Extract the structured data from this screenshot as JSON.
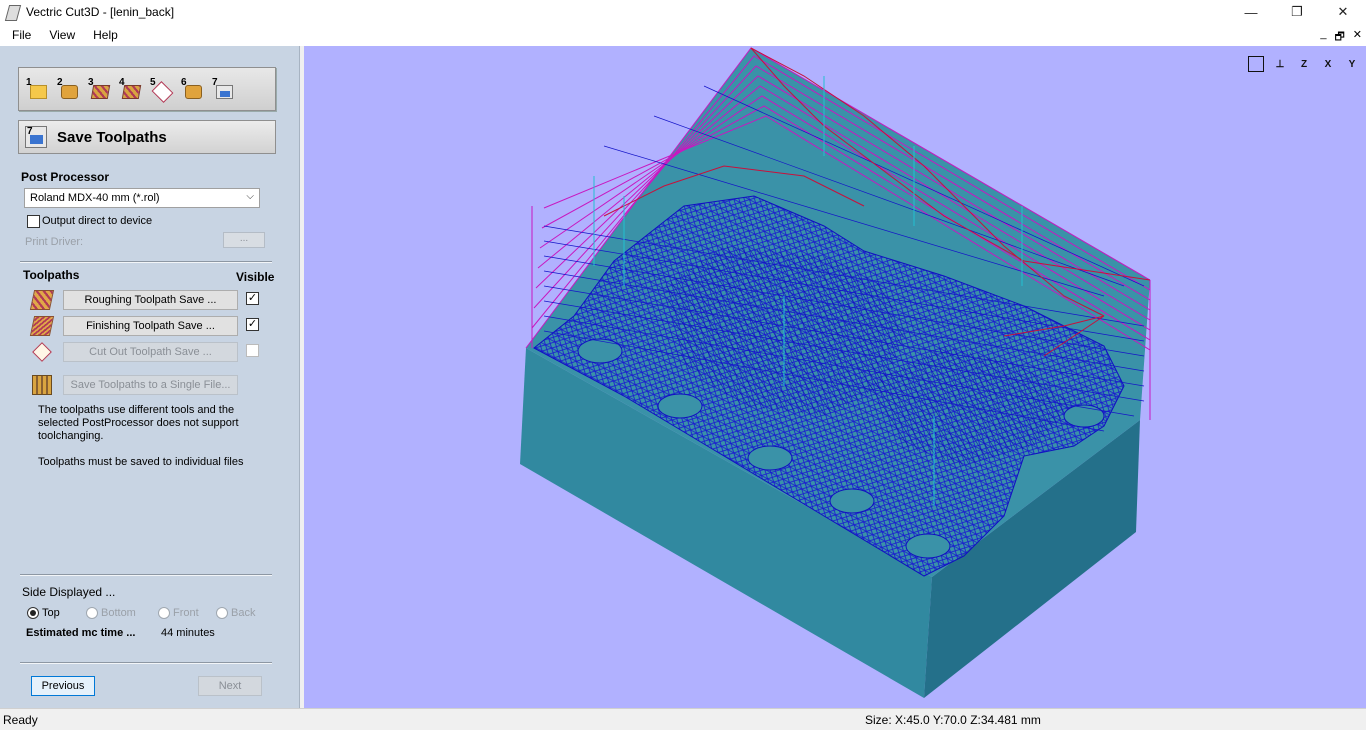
{
  "window": {
    "title": "Vectric Cut3D - [lenin_back]",
    "minimize": "—",
    "maximize": "❐",
    "close": "✕"
  },
  "menu": {
    "file": "File",
    "view": "View",
    "help": "Help"
  },
  "mdi": {
    "minimize": "_",
    "restore": "🗗",
    "close": "✕"
  },
  "steps": {
    "s1": "1",
    "s2": "2",
    "s3": "3",
    "s4": "4",
    "s5": "5",
    "s6": "6",
    "s7": "7"
  },
  "panel": {
    "title": "Save Toolpaths",
    "post_processor_label": "Post Processor",
    "post_processor_value": "Roland MDX-40 mm (*.rol)",
    "output_direct": "Output direct to device",
    "print_driver": "Print Driver:",
    "browse": "...",
    "toolpaths_label": "Toolpaths",
    "visible_label": "Visible",
    "toolpaths": [
      {
        "label": "Roughing Toolpath Save ...",
        "visible": "✓"
      },
      {
        "label": "Finishing Toolpath Save ...",
        "visible": "✓"
      },
      {
        "label": "Cut Out Toolpath Save ...",
        "visible": ""
      }
    ],
    "save_single": "Save Toolpaths to a Single File...",
    "info1": "The toolpaths use different tools and the selected PostProcessor does not support toolchanging.",
    "info2": "Toolpaths must be saved to individual files",
    "side_displayed": "Side Displayed ...",
    "sides": [
      "Top",
      "Bottom",
      "Front",
      "Back"
    ],
    "est_label": "Estimated mc time ...",
    "est_value": "44 minutes",
    "previous": "Previous",
    "next": "Next"
  },
  "view_icons": {
    "fit": "",
    "iso": "⊥",
    "z": "Z",
    "x": "X",
    "y": "Y"
  },
  "status": {
    "left": "Ready",
    "size": "Size: X:45.0 Y:70.0 Z:34.481 mm"
  },
  "colors": {
    "background": "#b1b1ff",
    "block_top": "#3a88a0",
    "block_front": "#3189a0",
    "block_side": "#256f86",
    "toolpath_blue": "#1010c0",
    "toolpath_red": "#c0104a",
    "toolpath_magenta": "#d010c0",
    "toolpath_cyan": "#20c0d0"
  }
}
